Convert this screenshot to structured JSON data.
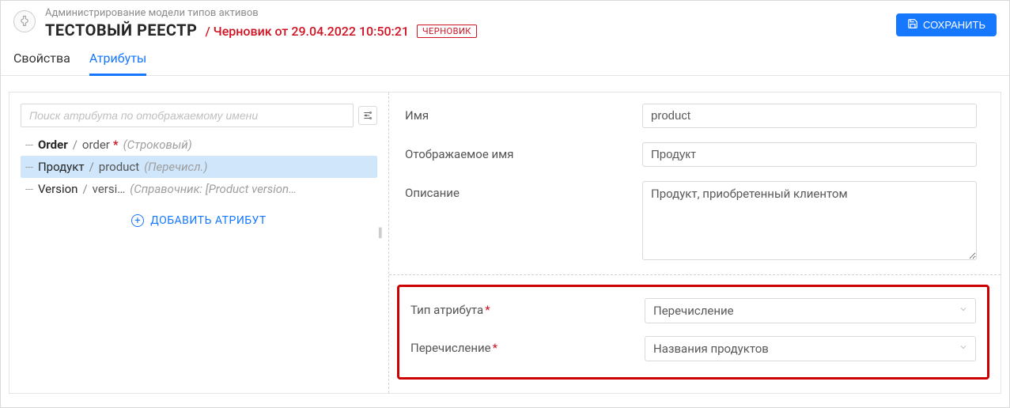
{
  "header": {
    "breadcrumb": "Администрирование модели типов активов",
    "title": "ТЕСТОВЫЙ РЕЕСТР",
    "draft_info": "/ Черновик от 29.04.2022 10:50:21",
    "draft_badge": "ЧЕРНОВИК",
    "save_button": "СОХРАНИТЬ"
  },
  "tabs": {
    "properties": "Свойства",
    "attributes": "Атрибуты"
  },
  "sidebar": {
    "search_placeholder": "Поиск атрибута по отображаемому имени",
    "add_attribute": "ДОБАВИТЬ АТРИБУТ",
    "items": [
      {
        "label": "Order",
        "name": "order",
        "required": true,
        "type": "(Строковый)",
        "selected": false,
        "truncated": false
      },
      {
        "label": "Продукт",
        "name": "product",
        "required": false,
        "type": "(Перечисл.)",
        "selected": true,
        "truncated": false
      },
      {
        "label": "Version",
        "name": "versi…",
        "required": false,
        "type": "(Справочник: [Product version…",
        "selected": false,
        "truncated": true
      }
    ]
  },
  "form": {
    "name_label": "Имя",
    "name_value": "product",
    "display_label": "Отображаемое имя",
    "display_value": "Продукт",
    "description_label": "Описание",
    "description_value": "Продукт, приобретенный клиентом",
    "attr_type_label": "Тип атрибута",
    "attr_type_value": "Перечисление",
    "enum_label": "Перечисление",
    "enum_value": "Названия продуктов"
  }
}
